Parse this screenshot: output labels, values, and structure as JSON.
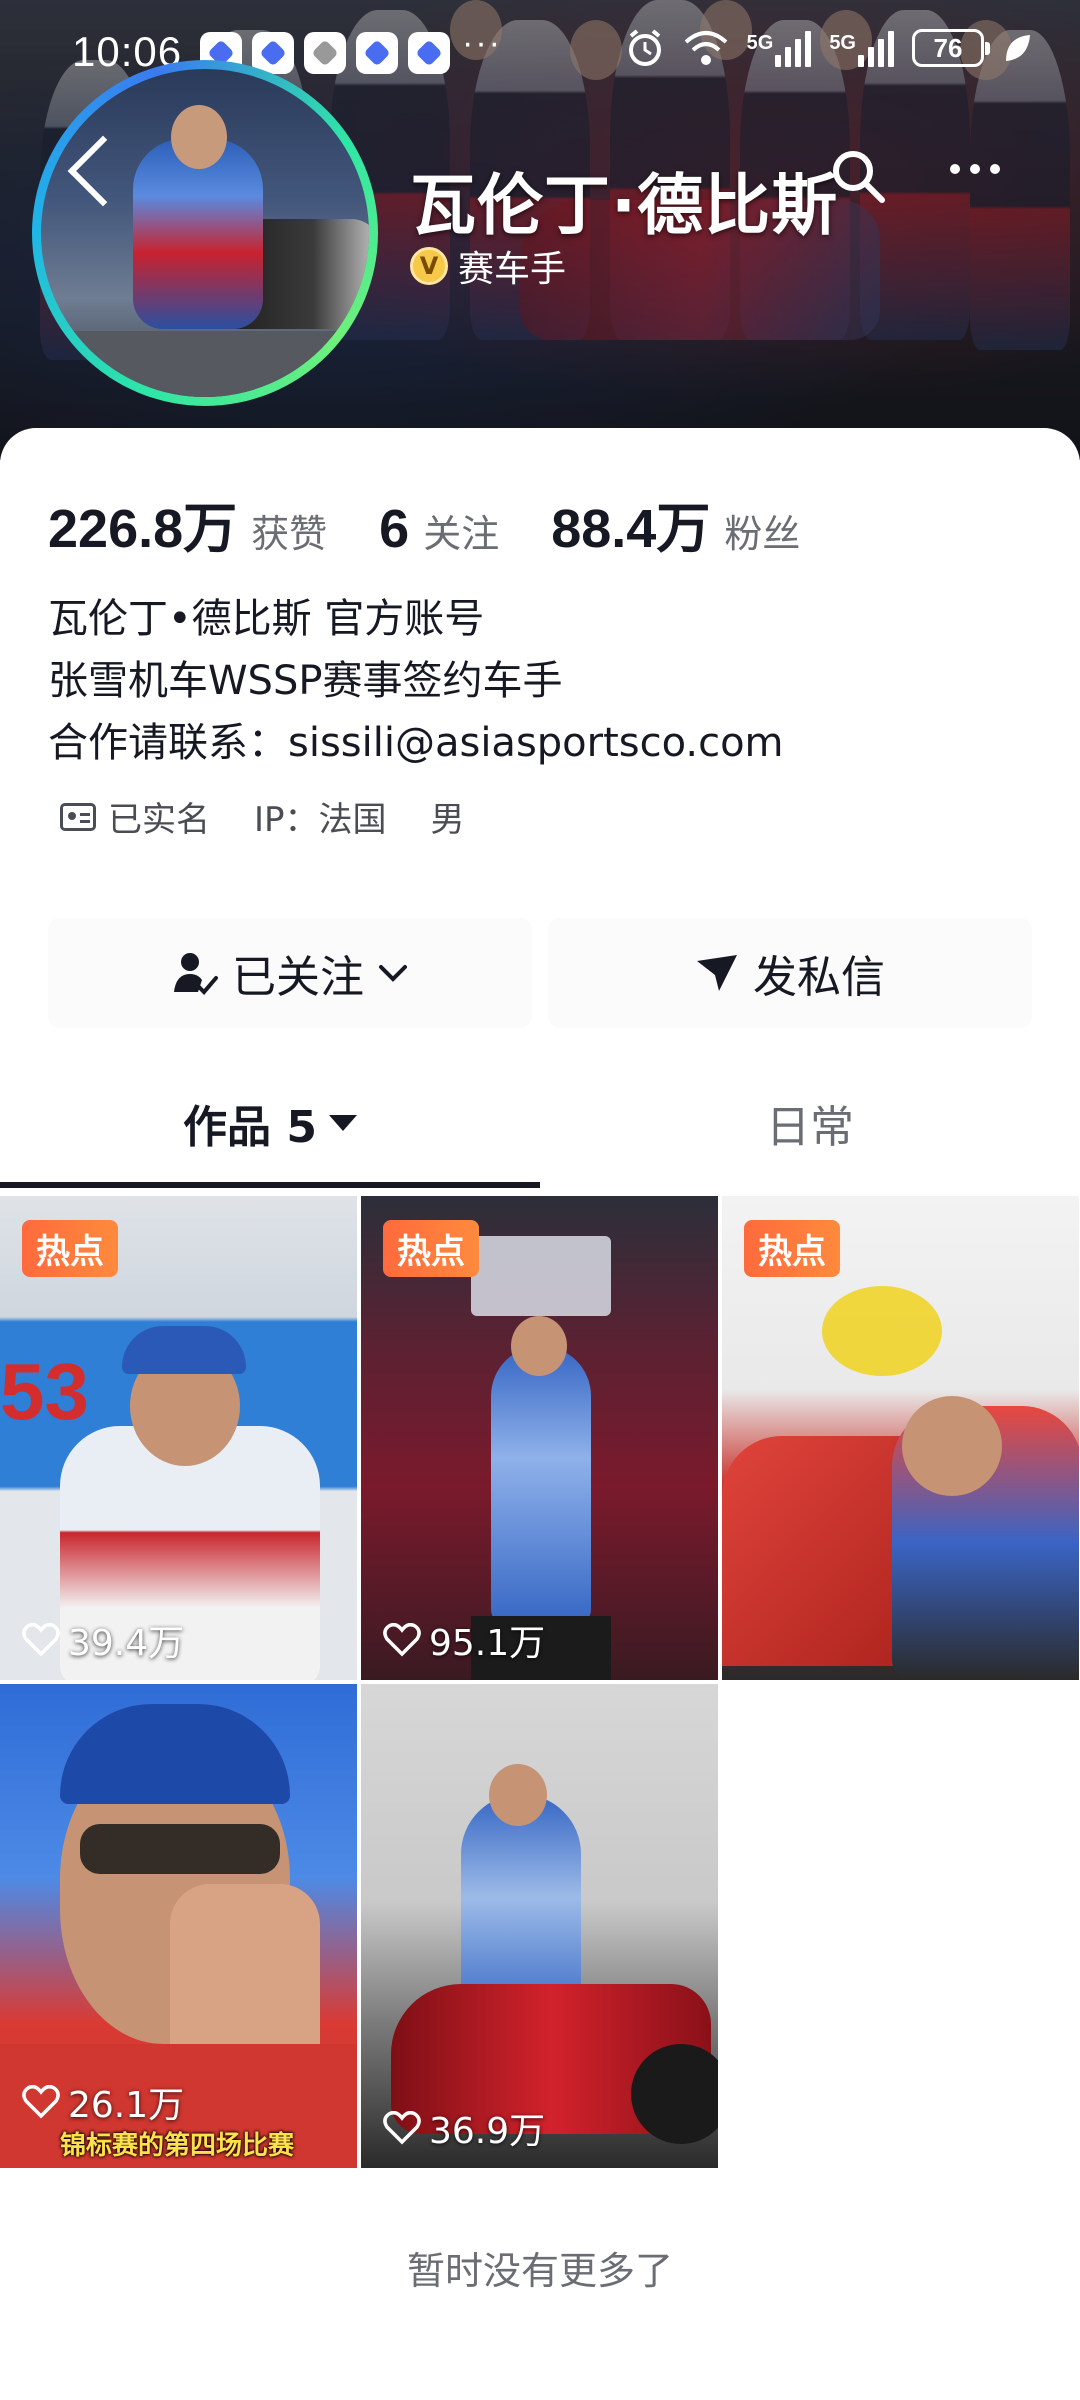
{
  "status_bar": {
    "time": "10:06",
    "network": "5G",
    "network2": "5G",
    "battery": "76",
    "overflow": "···"
  },
  "profile": {
    "name": "瓦伦丁·德比斯",
    "verification_label": "赛车手",
    "verification_badge": "V",
    "stats": [
      {
        "value": "226.8万",
        "label": "获赞"
      },
      {
        "value": "6",
        "label": "关注"
      },
      {
        "value": "88.4万",
        "label": "粉丝"
      }
    ],
    "bio_lines": [
      "瓦伦丁•德比斯 官方账号",
      "张雪机车WSSP赛事签约车手",
      "合作请联系：sissili@asiasportsco.com"
    ],
    "meta": {
      "verified": "已实名",
      "ip": "IP：法国",
      "gender": "男"
    }
  },
  "actions": {
    "follow": "已关注",
    "message": "发私信"
  },
  "tabs": {
    "works": "作品 5",
    "daily": "日常"
  },
  "videos": [
    {
      "badge": "热点",
      "likes": "39.4万"
    },
    {
      "badge": "热点",
      "likes": "95.1万"
    },
    {
      "badge": "热点",
      "likes": ""
    },
    {
      "badge": "",
      "likes": "26.1万",
      "caption": "锦标赛的第四场比赛"
    },
    {
      "badge": "",
      "likes": "36.9万"
    }
  ],
  "footer": {
    "end_text": "暂时没有更多了"
  },
  "colors": {
    "hot_badge": "#ff6a3d",
    "text_primary": "#161823",
    "text_secondary": "#6b6d74",
    "avatar_ring": "#2ee6a6"
  }
}
